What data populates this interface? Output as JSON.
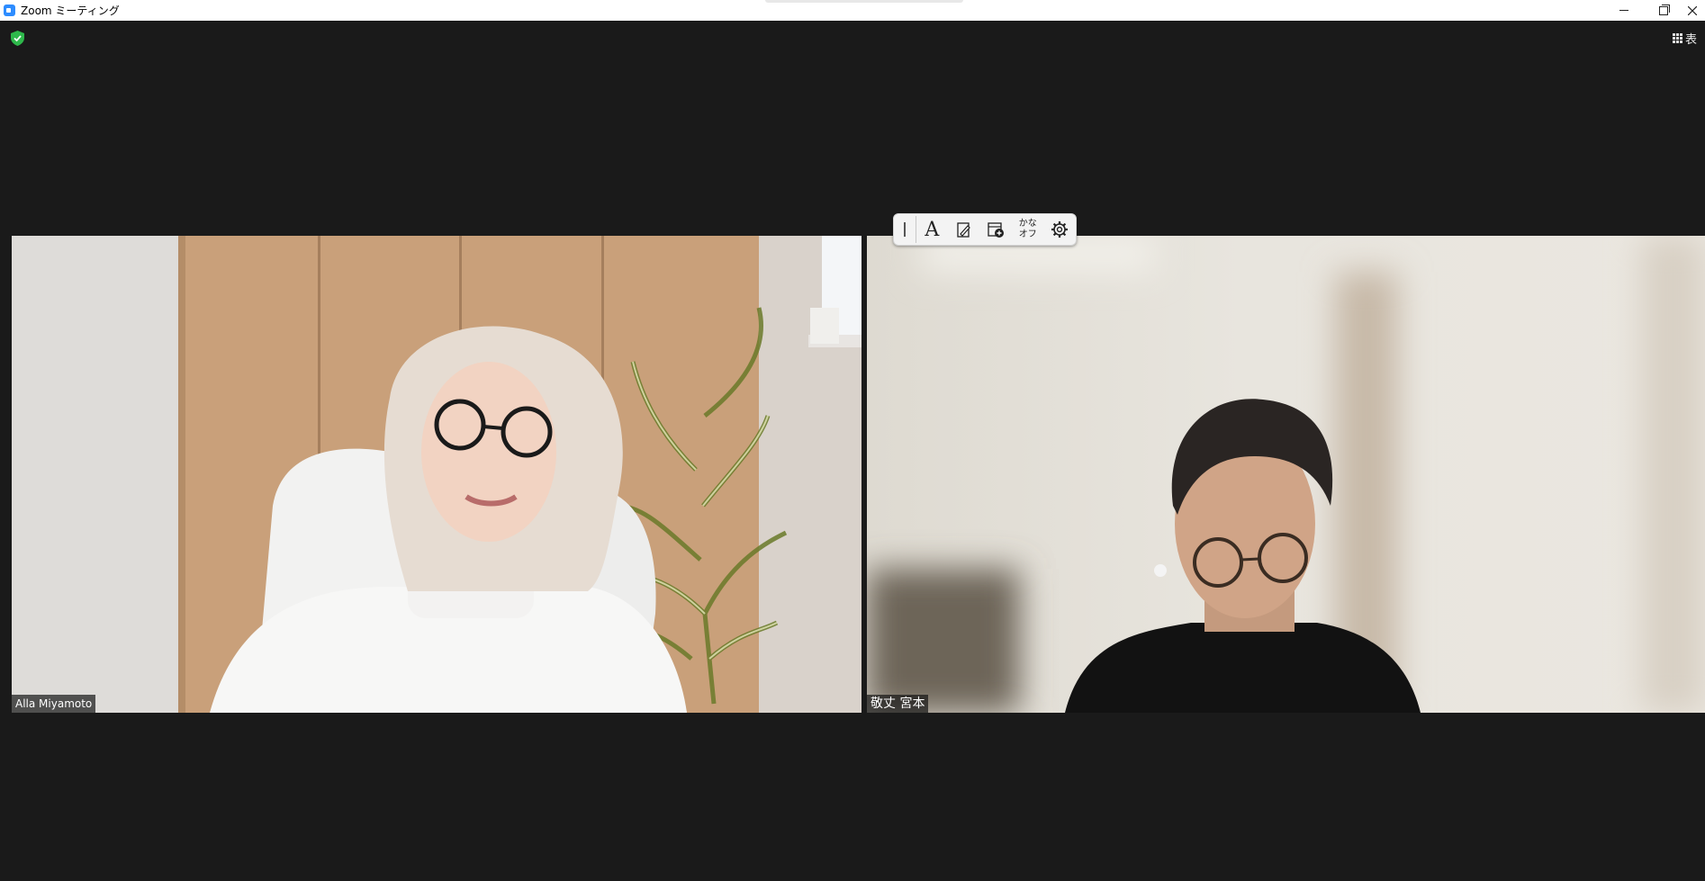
{
  "window": {
    "title": "Zoom ミーティング",
    "controls": {
      "minimize": "minimize-icon",
      "maximize": "restore-icon",
      "close": "close-icon"
    }
  },
  "security": {
    "icon": "shield-check-icon",
    "color": "#2eb84b"
  },
  "view_button": {
    "label": "表",
    "icon": "grid-icon"
  },
  "ime_toolbar": {
    "mode_glyph": "A",
    "kana_label": "かな\nオフ",
    "icons": [
      "grip-icon",
      "input-mode-icon",
      "handwriting-pad-icon",
      "dictionary-add-icon",
      "kana-input-toggle",
      "settings-gear-icon"
    ]
  },
  "participants": [
    {
      "name": "Alla Miyamoto"
    },
    {
      "name": "敬丈 宮本"
    }
  ],
  "colors": {
    "background": "#1a1a1a",
    "accent": "#2d8cff"
  }
}
